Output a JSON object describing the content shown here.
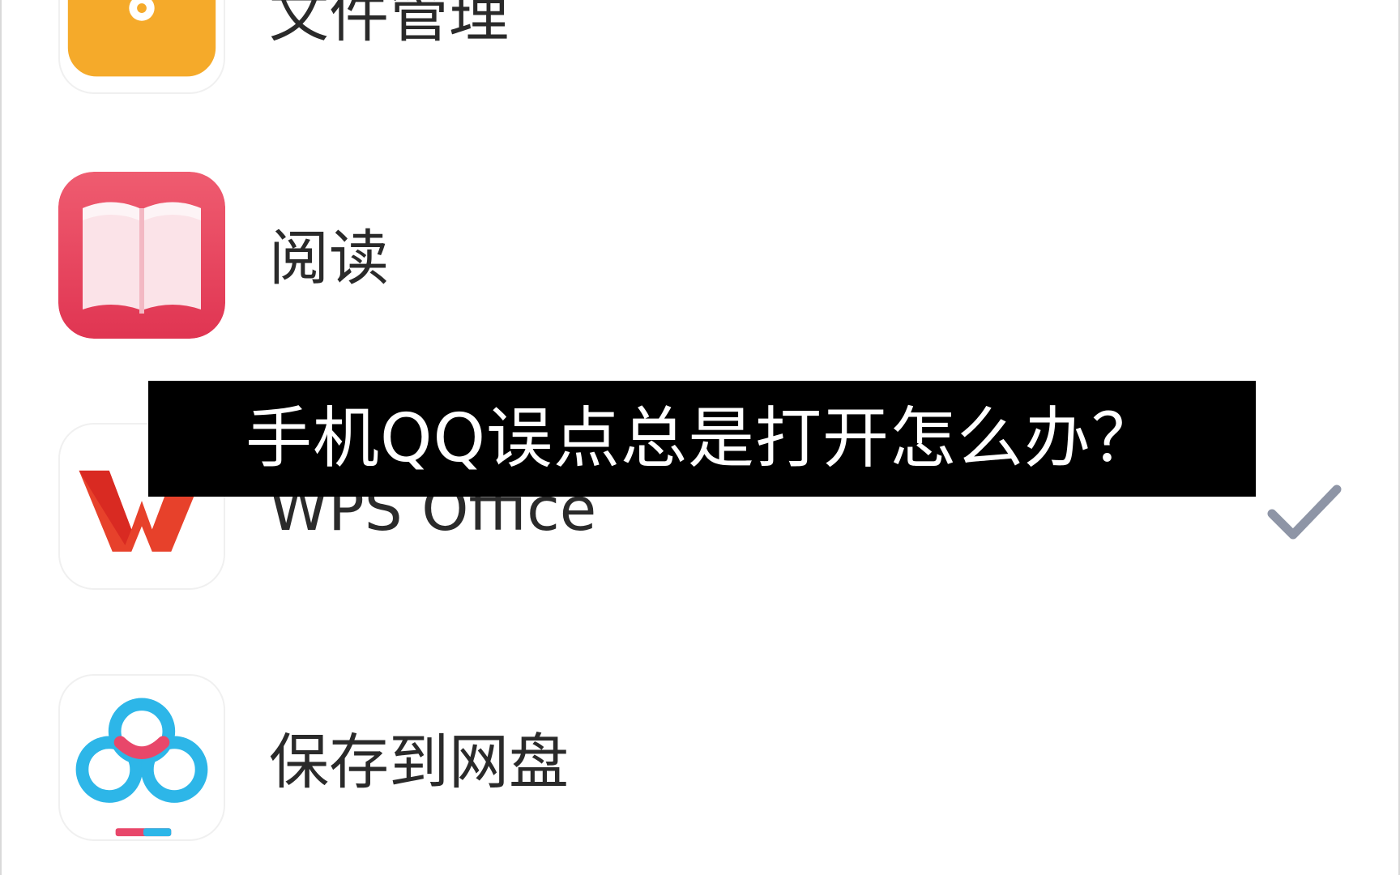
{
  "apps": [
    {
      "id": "file-manager",
      "label": "文件管理",
      "icon": "folder-icon",
      "color": "#F5A623"
    },
    {
      "id": "reading",
      "label": "阅读",
      "icon": "book-icon",
      "color": "#E8475F"
    },
    {
      "id": "wps",
      "label": "WPS Office",
      "icon": "wps-icon",
      "color": "#E33D2A",
      "selected": true
    },
    {
      "id": "netdisk",
      "label": "保存到网盘",
      "icon": "baidu-netdisk-icon",
      "color": "#2FB5E6"
    }
  ],
  "selected_indicator": "check-icon",
  "subtitle": {
    "text": "手机QQ误点总是打开怎么办？"
  }
}
